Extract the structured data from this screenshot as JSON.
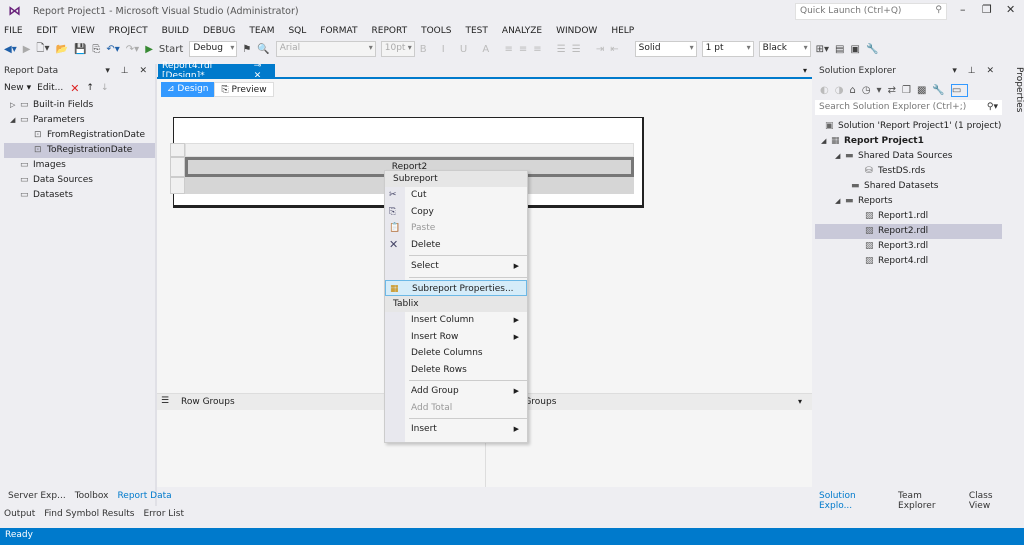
{
  "window": {
    "title": "Report Project1 - Microsoft Visual Studio (Administrator)",
    "quick_launch_placeholder": "Quick Launch (Ctrl+Q)"
  },
  "menu": [
    "FILE",
    "EDIT",
    "VIEW",
    "PROJECT",
    "BUILD",
    "DEBUG",
    "TEAM",
    "SQL",
    "FORMAT",
    "REPORT",
    "TOOLS",
    "TEST",
    "ANALYZE",
    "WINDOW",
    "HELP"
  ],
  "toolbar": {
    "start": "Start",
    "config": "Debug",
    "font": "Arial",
    "size": "10pt",
    "border_style": "Solid",
    "border_width": "1 pt",
    "border_color": "Black"
  },
  "report_data": {
    "title": "Report Data",
    "new": "New",
    "edit": "Edit...",
    "items": [
      {
        "label": "Built-in Fields",
        "level": 0,
        "twisty": "▷"
      },
      {
        "label": "Parameters",
        "level": 0,
        "twisty": "◢"
      },
      {
        "label": "FromRegistrationDate",
        "level": 1
      },
      {
        "label": "ToRegistrationDate",
        "level": 1,
        "selected": true
      },
      {
        "label": "Images",
        "level": 0
      },
      {
        "label": "Data Sources",
        "level": 0
      },
      {
        "label": "Datasets",
        "level": 0
      }
    ]
  },
  "document": {
    "tab": "Report4.rdl [Design]*",
    "design": "Design",
    "preview": "Preview",
    "cell_text": "Report2",
    "row_groups": "Row Groups",
    "column_groups": "Column Groups"
  },
  "context_menu": {
    "header1": "Subreport",
    "cut": "Cut",
    "copy": "Copy",
    "paste": "Paste",
    "delete": "Delete",
    "select": "Select",
    "properties": "Subreport Properties...",
    "header2": "Tablix",
    "insert_column": "Insert Column",
    "insert_row": "Insert Row",
    "delete_columns": "Delete Columns",
    "delete_rows": "Delete Rows",
    "add_group": "Add Group",
    "add_total": "Add Total",
    "insert": "Insert"
  },
  "solution_explorer": {
    "title": "Solution Explorer",
    "search_placeholder": "Search Solution Explorer (Ctrl+;)",
    "items": [
      {
        "label": "Solution 'Report Project1' (1 project)"
      },
      {
        "label": "Report Project1"
      },
      {
        "label": "Shared Data Sources"
      },
      {
        "label": "TestDS.rds"
      },
      {
        "label": "Shared Datasets"
      },
      {
        "label": "Reports"
      },
      {
        "label": "Report1.rdl"
      },
      {
        "label": "Report2.rdl",
        "selected": true
      },
      {
        "label": "Report3.rdl"
      },
      {
        "label": "Report4.rdl"
      }
    ]
  },
  "properties_tab": "Properties",
  "left_tabs": [
    "Server Exp...",
    "Toolbox",
    "Report Data"
  ],
  "right_tabs": [
    "Solution Explo...",
    "Team Explorer",
    "Class View"
  ],
  "bottom_tabs": [
    "Output",
    "Find Symbol Results",
    "Error List"
  ],
  "status": "Ready",
  "colors": {
    "accent": "#007acc",
    "brand": "#68217a"
  }
}
